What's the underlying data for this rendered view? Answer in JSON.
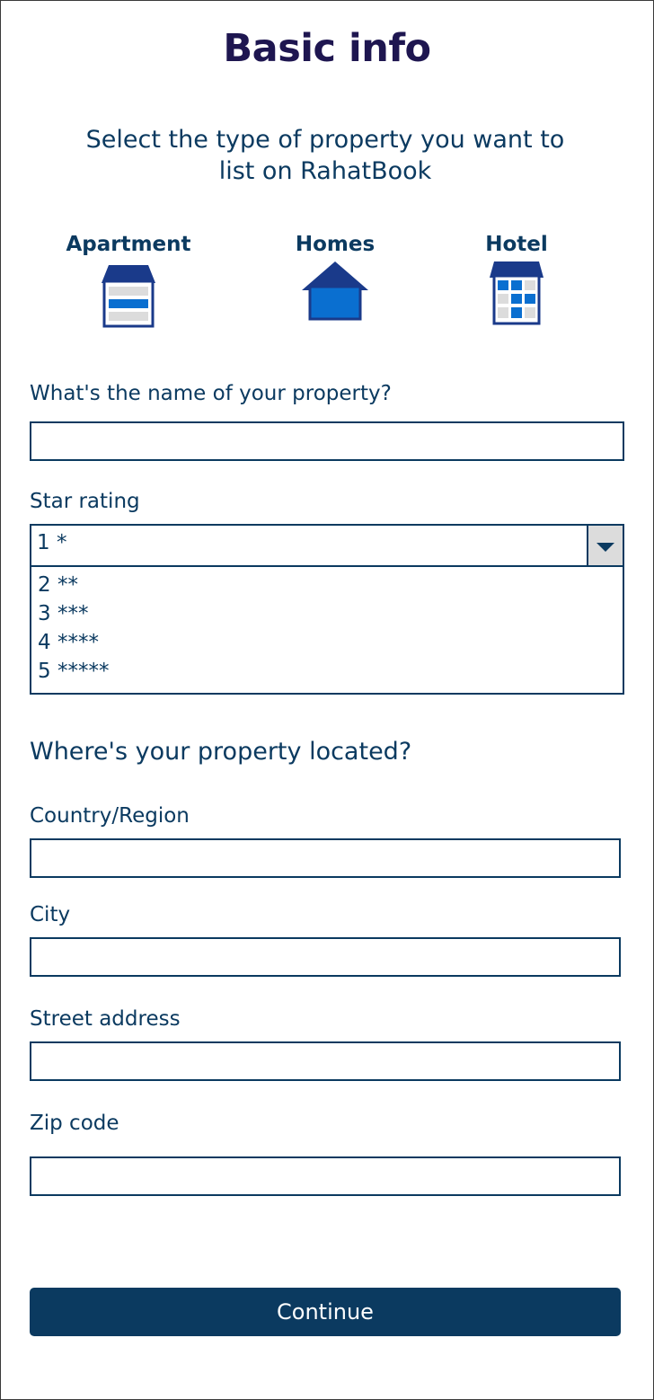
{
  "page": {
    "title": "Basic info",
    "subtitle": "Select the type of property you want to list on RahatBook"
  },
  "property_types": [
    {
      "label": "Apartment",
      "icon": "apartment-icon"
    },
    {
      "label": "Homes",
      "icon": "home-icon"
    },
    {
      "label": "Hotel",
      "icon": "hotel-icon"
    }
  ],
  "form": {
    "name_label": "What's the name of your property?",
    "name_value": "",
    "star_label": "Star rating",
    "star_selected": "1 *",
    "star_options": [
      "2 **",
      "3 ***",
      "4 ****",
      "5 *****"
    ]
  },
  "location": {
    "heading": "Where's your property located?",
    "country_label": "Country/Region",
    "city_label": "City",
    "street_label": "Street address",
    "zip_label": "Zip code"
  },
  "actions": {
    "continue_label": "Continue"
  },
  "colors": {
    "primary": "#0b3a60",
    "title": "#1e1650",
    "icon_navy": "#1a3a8a",
    "icon_blue": "#0a6fd0",
    "icon_grey": "#dcdcdc"
  }
}
